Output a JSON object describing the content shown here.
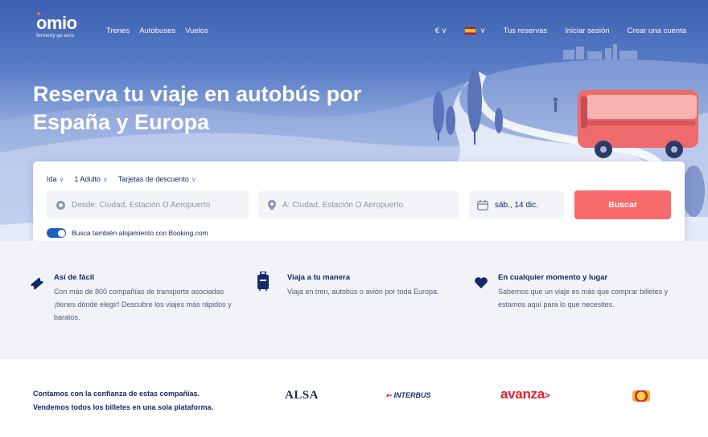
{
  "header": {
    "logo": "omio",
    "logo_sub": "formerly go euro",
    "nav": [
      "Trenes",
      "Autobuses",
      "Vuelos"
    ],
    "currency": "€",
    "account": [
      "Tus reservas",
      "Iniciar sesión",
      "Crear una cuenta"
    ]
  },
  "hero": {
    "title": "Reserva tu viaje en autobús por España y Europa"
  },
  "search": {
    "trip_type": "Ida",
    "passengers": "1 Adulto",
    "discount_cards": "Tarjetas de descuento",
    "from_placeholder": "Desde: Ciudad, Estación O Aeropuerto",
    "to_placeholder": "A: Ciudad, Estación O Aeropuerto",
    "date": "sáb., 14 dic.",
    "button": "Buscar",
    "booking_toggle_label": "Busca también alojamiento con Booking.com",
    "booking_toggle_on": true
  },
  "features": [
    {
      "title": "Así de fácil",
      "text": "Con más de 800 compañías de transporte asociadas ¡tienes dónde elegir! Descubre los viajes más rápidos y baratos.",
      "icon": "ticket-icon"
    },
    {
      "title": "Viaja a tu manera",
      "text": "Viaja en tren, autobús o avión por toda Europa.",
      "icon": "luggage-icon"
    },
    {
      "title": "En cualquier momento y lugar",
      "text": "Sabemos que un viaje es más que comprar billetes y estamos aquí para lo que necesites.",
      "icon": "heart-icon"
    }
  ],
  "trust": {
    "lines": [
      "Contamos con la confianza de estas compañías.",
      "Vendemos todos los billetes en una sola plataforma."
    ],
    "partners": [
      "ALSA",
      "INTERBUS",
      "avanza"
    ]
  },
  "colors": {
    "accent": "#fa6b6b",
    "navy": "#132968",
    "toggle": "#1f5ebd"
  }
}
